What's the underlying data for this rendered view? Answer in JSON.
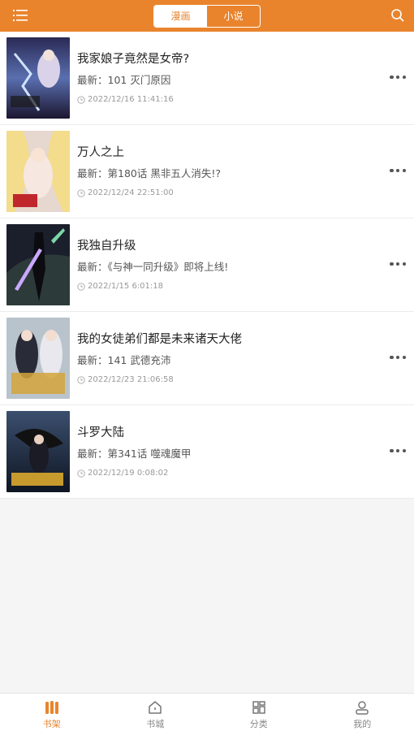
{
  "colors": {
    "accent": "#e9842d",
    "text": "#222222",
    "muted": "#999999"
  },
  "header": {
    "menu_icon": "list-menu-icon",
    "search_icon": "search-icon",
    "tabs": [
      {
        "label": "漫画",
        "active": true
      },
      {
        "label": "小说",
        "active": false
      }
    ]
  },
  "shelf": {
    "items": [
      {
        "title": "我家娘子竟然是女帝?",
        "latest": "最新：101 灭门原因",
        "time": "2022/12/16 11:41:16"
      },
      {
        "title": "万人之上",
        "latest": "最新：第180话 黑非五人消失!?",
        "time": "2022/12/24 22:51:00"
      },
      {
        "title": "我独自升级",
        "latest": "最新：《与神一同升级》即将上线!",
        "time": "2022/1/15 6:01:18"
      },
      {
        "title": "我的女徒弟们都是未来诸天大佬",
        "latest": "最新：141 武德充沛",
        "time": "2022/12/23 21:06:58"
      },
      {
        "title": "斗罗大陆",
        "latest": "最新：第341话 噬魂魔甲",
        "time": "2022/12/19 0:08:02"
      }
    ]
  },
  "nav": {
    "items": [
      {
        "label": "书架",
        "icon": "bookshelf-icon",
        "active": true
      },
      {
        "label": "书城",
        "icon": "home-icon",
        "active": false
      },
      {
        "label": "分类",
        "icon": "category-grid-icon",
        "active": false
      },
      {
        "label": "我的",
        "icon": "user-icon",
        "active": false
      }
    ]
  }
}
